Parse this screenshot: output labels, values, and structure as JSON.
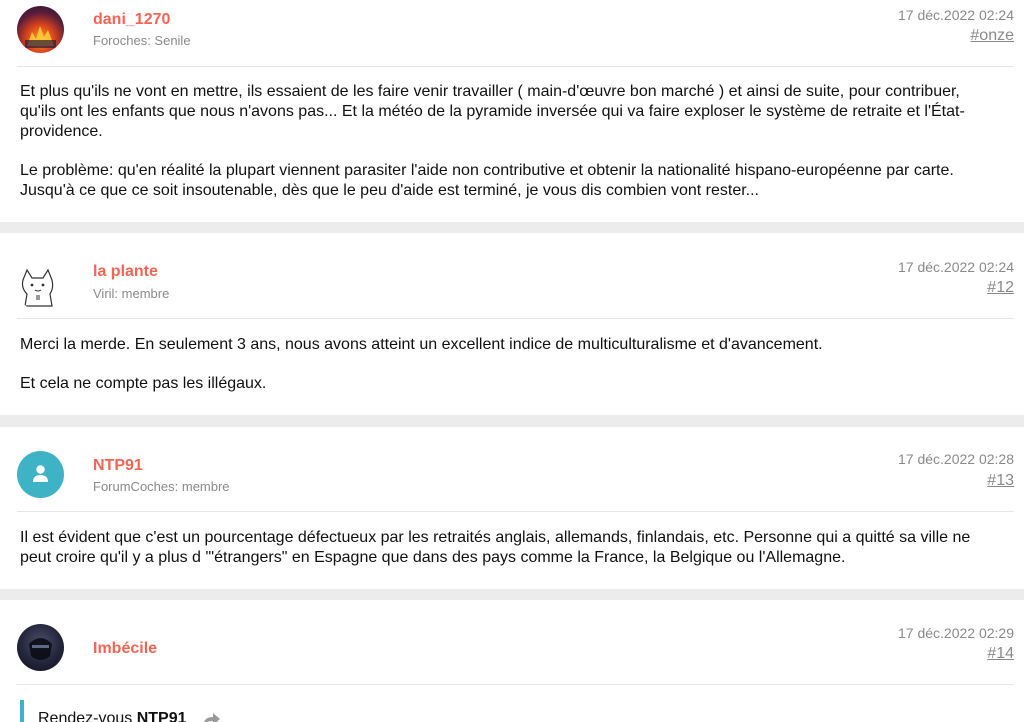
{
  "posts": [
    {
      "username": "dani_1270",
      "user_title": "Foroches: Senile",
      "avatar": "avatar-image-fire",
      "date": "17 déc.2022 02:24",
      "permalink": "#onze",
      "paragraphs": [
        "Et plus qu'ils ne vont en mettre, ils essaient de les faire venir travailler ( main-d'œuvre bon marché ) et ainsi de suite, pour contribuer, qu'ils ont les enfants que nous n'avons pas... Et la météo de la pyramide inversée qui va faire exploser le système de retraite et l'État-providence.",
        "Le problème: qu'en réalité la plupart viennent parasiter l'aide non contributive et obtenir la nationalité hispano-européenne par carte. Jusqu'à ce que ce soit insoutenable, dès que le peu d'aide est terminé, je vous dis combien vont rester..."
      ]
    },
    {
      "username": "la plante",
      "user_title": "Viril: membre",
      "avatar": "avatar-cat-sketch",
      "date": "17 déc.2022 02:24",
      "permalink": "#12",
      "paragraphs": [
        "Merci la merde. En seulement 3 ans, nous avons atteint un excellent indice de multiculturalisme et d'avancement.",
        "Et cela ne compte pas les illégaux."
      ]
    },
    {
      "username": "NTP91",
      "user_title": "ForumCoches: membre",
      "avatar": "user-icon",
      "date": "17 déc.2022 02:28",
      "permalink": "#13",
      "paragraphs": [
        "Il est évident que c'est un pourcentage défectueux par les retraités anglais, allemands, finlandais, etc. Personne qui a quitté sa ville ne peut croire qu'il y a plus d '\"étrangers\" en Espagne que dans des pays comme la France, la Belgique ou l'Allemagne."
      ]
    },
    {
      "username": "Imbécile",
      "user_title": "",
      "avatar": "avatar-image-dark",
      "date": "17 déc.2022 02:29",
      "permalink": "#14",
      "quote": {
        "prefix": "Rendez-vous ",
        "user": "NTP91"
      }
    }
  ],
  "colors": {
    "username": "#f46453",
    "quote_bar": "#3fb3c6",
    "user_icon_bg": "#3fb3c6"
  }
}
